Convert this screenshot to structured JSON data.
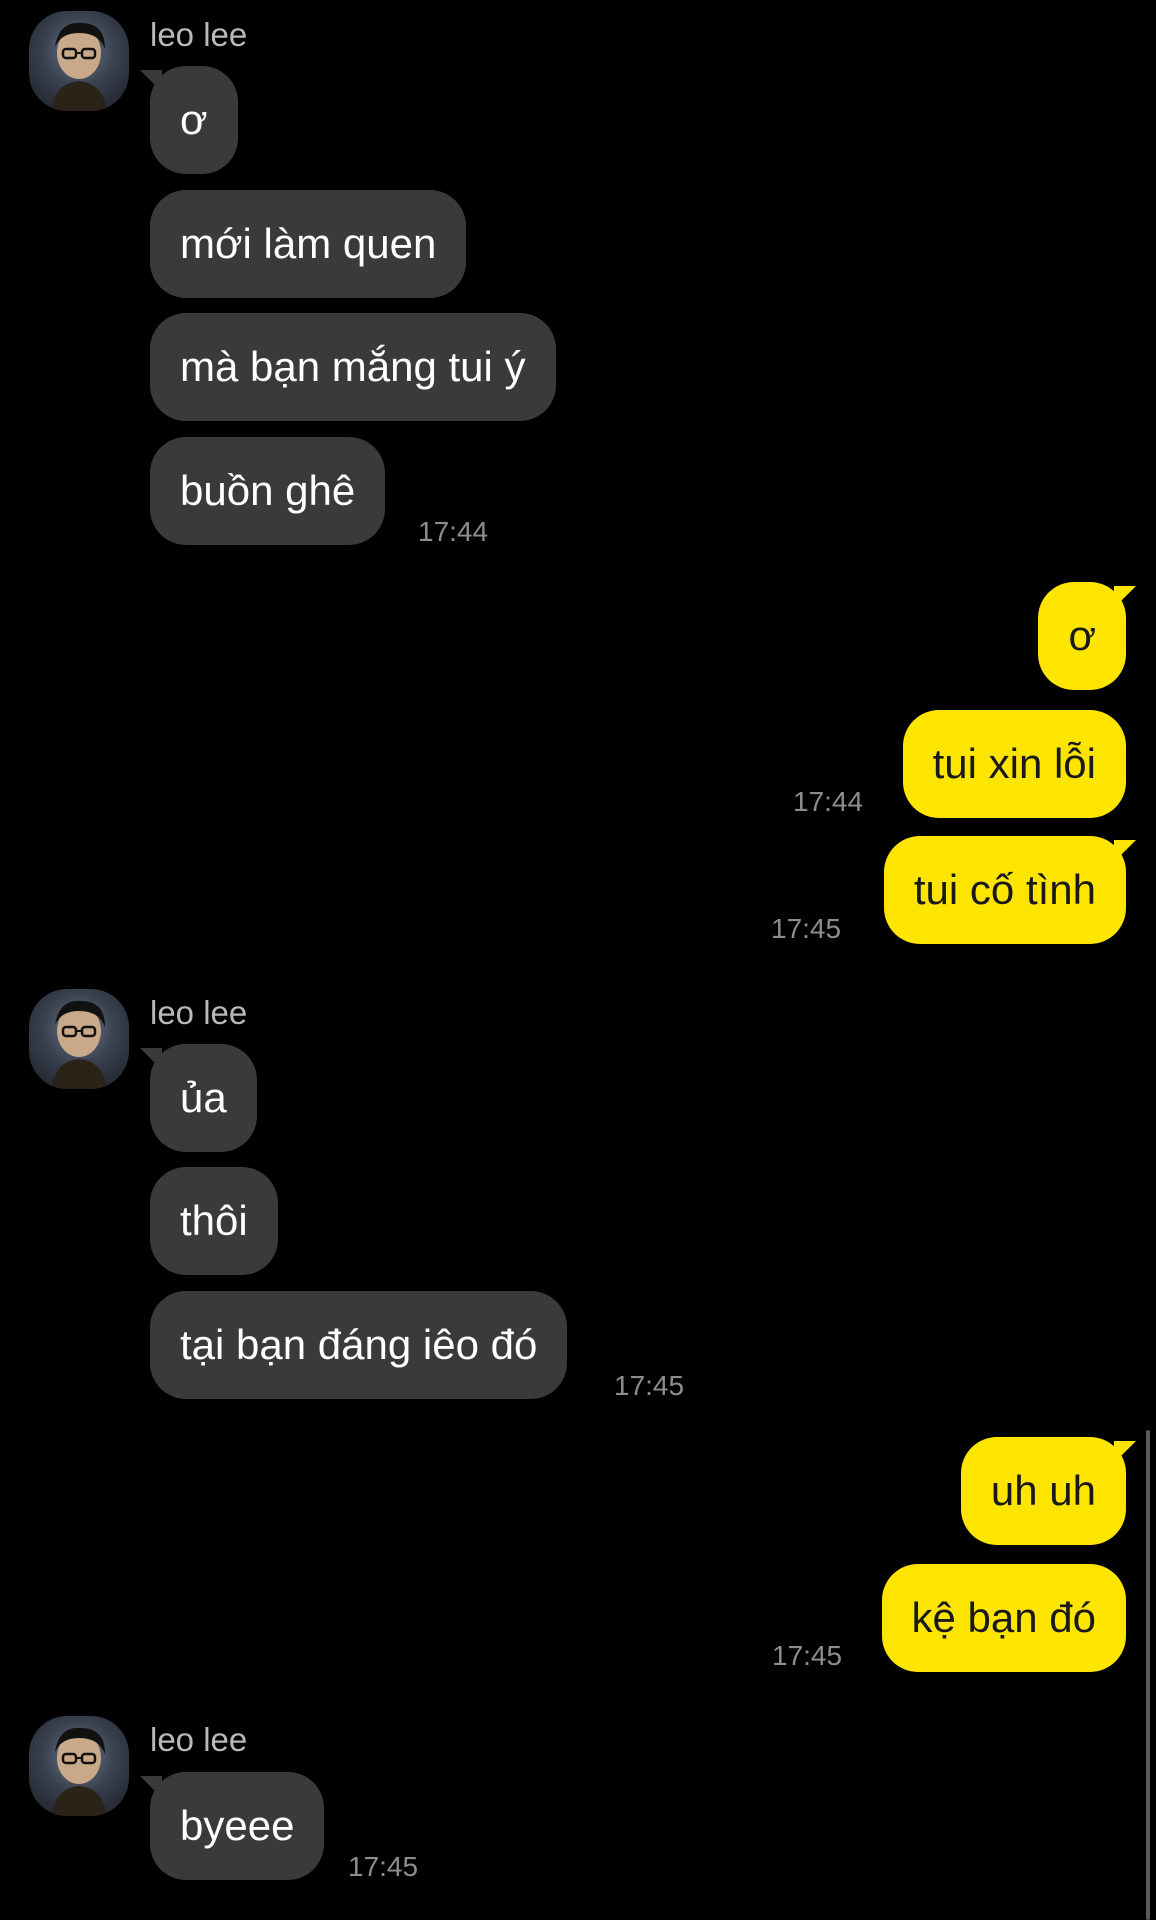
{
  "theme": {
    "incoming_bubble": "#3a3a3c",
    "outgoing_bubble": "#fee500",
    "background": "#000000"
  },
  "groups": [
    {
      "sender": "leo lee",
      "messages": [
        "ơ",
        "mới làm quen",
        "mà bạn mắng tui ý",
        "buồn ghê"
      ],
      "time": "17:44"
    },
    {
      "outgoing": true,
      "messages": [
        "ơ",
        "tui xin lỗi",
        "tui cố tình"
      ],
      "times": [
        "17:44",
        "17:45"
      ]
    },
    {
      "sender": "leo lee",
      "messages": [
        "ủa",
        "thôi",
        "tại bạn đáng iêo đó"
      ],
      "time": "17:45"
    },
    {
      "outgoing": true,
      "messages": [
        "uh uh",
        "kệ bạn đó"
      ],
      "time": "17:45"
    },
    {
      "sender": "leo lee",
      "messages": [
        "byeee"
      ],
      "time": "17:45"
    }
  ]
}
